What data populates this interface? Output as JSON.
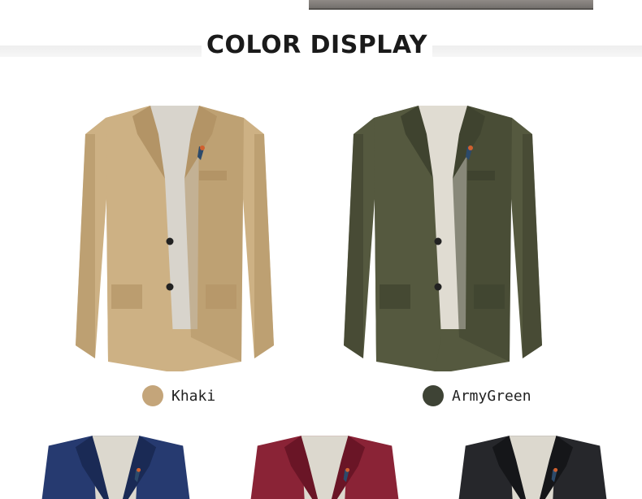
{
  "section": {
    "title": "COLOR DISPLAY"
  },
  "colors": [
    {
      "id": "khaki",
      "label": "Khaki",
      "swatch": "#c4a57a",
      "body": "#cdb184",
      "shade": "#b39466",
      "lining": "#d8d4cc"
    },
    {
      "id": "armygreen",
      "label": "ArmyGreen",
      "swatch": "#3e4335",
      "body": "#55593f",
      "shade": "#3f432f",
      "lining": "#e0dcd2"
    },
    {
      "id": "navy",
      "label": "",
      "swatch": "#1f2f5e",
      "body": "#263a70",
      "shade": "#1a2a55",
      "lining": "#dcd8ce"
    },
    {
      "id": "wine",
      "label": "",
      "swatch": "#7e1d2e",
      "body": "#8a2336",
      "shade": "#6a1526",
      "lining": "#dcd8ce"
    },
    {
      "id": "black",
      "label": "",
      "swatch": "#1e1f22",
      "body": "#26272b",
      "shade": "#151619",
      "lining": "#dcd8ce"
    }
  ]
}
